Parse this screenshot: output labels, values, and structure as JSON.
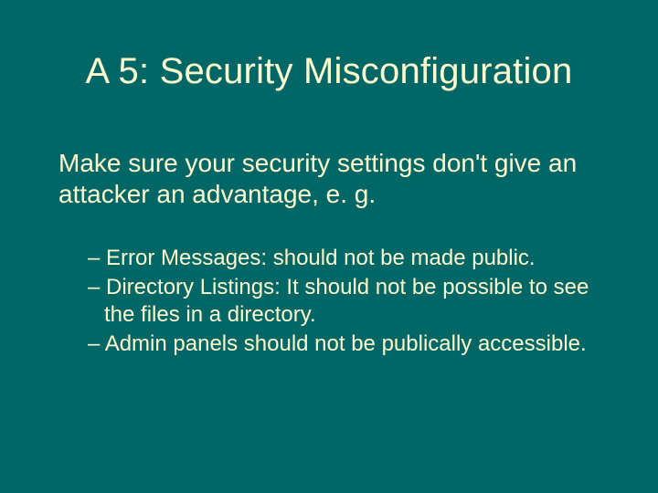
{
  "title": "A 5: Security Misconfiguration",
  "intro": "Make sure your security settings don't give an attacker an advantage, e. g.",
  "bullets": [
    "Error Messages: should not be made public.",
    "Directory Listings: It should not be possible to see the files in a directory.",
    "Admin panels should not be publically accessible."
  ]
}
